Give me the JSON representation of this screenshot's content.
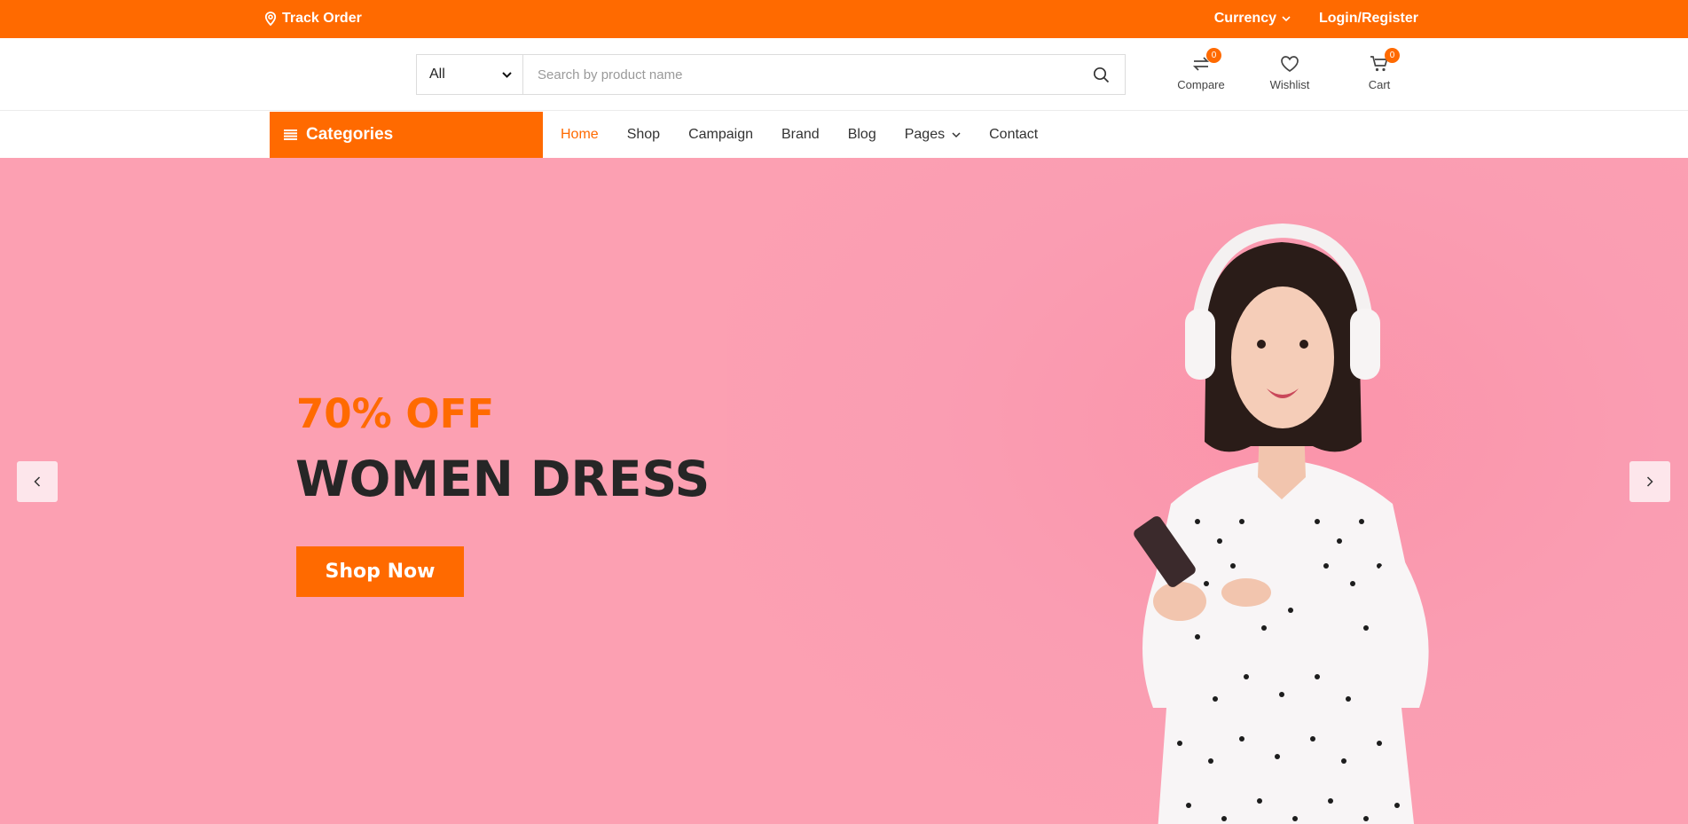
{
  "topbar": {
    "track_order": "Track Order",
    "currency": "Currency",
    "login": "Login/Register"
  },
  "search": {
    "category": "All",
    "placeholder": "Search by product name"
  },
  "actions": {
    "compare": {
      "label": "Compare",
      "count": "0"
    },
    "wishlist": {
      "label": "Wishlist"
    },
    "cart": {
      "label": "Cart",
      "count": "0"
    }
  },
  "nav": {
    "categories": "Categories",
    "items": [
      "Home",
      "Shop",
      "Campaign",
      "Brand",
      "Blog",
      "Pages",
      "Contact"
    ]
  },
  "hero": {
    "discount": "70% OFF",
    "title": "WOMEN DRESS",
    "cta": "Shop Now"
  },
  "colors": {
    "accent": "#ff6a00",
    "hero_bg": "#fca0b2"
  }
}
